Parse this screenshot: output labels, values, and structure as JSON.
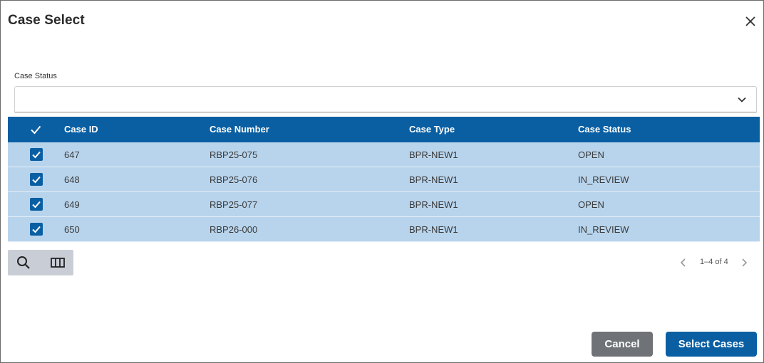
{
  "dialog": {
    "title": "Case Select",
    "close_icon": "close-icon"
  },
  "filter": {
    "label": "Case Status",
    "value": "",
    "icon": "chevron-down-icon"
  },
  "table": {
    "columns": [
      "Case ID",
      "Case Number",
      "Case Type",
      "Case Status"
    ],
    "rows": [
      {
        "id": "647",
        "number": "RBP25-075",
        "type": "BPR-NEW1",
        "status": "OPEN",
        "checked": true
      },
      {
        "id": "648",
        "number": "RBP25-076",
        "type": "BPR-NEW1",
        "status": "IN_REVIEW",
        "checked": true
      },
      {
        "id": "649",
        "number": "RBP25-077",
        "type": "BPR-NEW1",
        "status": "OPEN",
        "checked": true
      },
      {
        "id": "650",
        "number": "RBP26-000",
        "type": "BPR-NEW1",
        "status": "IN_REVIEW",
        "checked": true
      }
    ],
    "header_color": "#0a5fa3",
    "selected_row_color": "#b8d4ec"
  },
  "toolbar": {
    "icons": [
      "search-icon",
      "columns-icon"
    ]
  },
  "pagination": {
    "text": "1–4 of 4"
  },
  "actions": {
    "cancel_label": "Cancel",
    "select_label": "Select Cases"
  }
}
